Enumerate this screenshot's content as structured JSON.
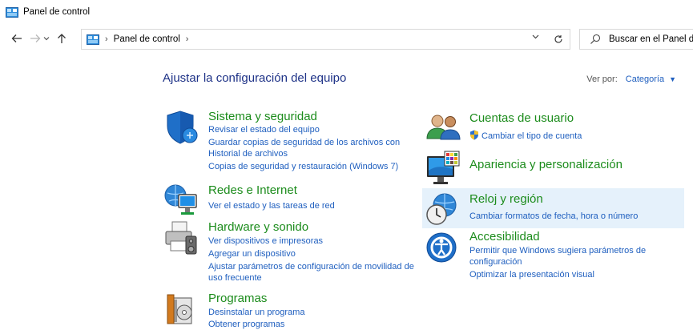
{
  "window": {
    "title": "Panel de control"
  },
  "address": {
    "crumb": "Panel de control",
    "separator": "›"
  },
  "search": {
    "placeholder": "Buscar en el Panel de"
  },
  "heading": "Ajustar la configuración del equipo",
  "view_by": {
    "label": "Ver por:",
    "value": "Categoría"
  },
  "categories": {
    "system": {
      "title": "Sistema y seguridad",
      "links": [
        "Revisar el estado del equipo",
        "Guardar copias de seguridad de los archivos con",
        "Historial de archivos",
        "Copias de seguridad y restauración (Windows 7)"
      ]
    },
    "network": {
      "title": "Redes e Internet",
      "links": [
        "Ver el estado y las tareas de red"
      ]
    },
    "hardware": {
      "title": "Hardware y sonido",
      "links": [
        "Ver dispositivos e impresoras",
        "Agregar un dispositivo",
        "Ajustar parámetros de configuración de movilidad de",
        "uso frecuente"
      ]
    },
    "programs": {
      "title": "Programas",
      "links": [
        "Desinstalar un programa",
        "Obtener programas"
      ]
    },
    "users": {
      "title": "Cuentas de usuario",
      "links": [
        "Cambiar el tipo de cuenta"
      ]
    },
    "appearance": {
      "title": "Apariencia y personalización",
      "links": []
    },
    "clock": {
      "title": "Reloj y región",
      "links": [
        "Cambiar formatos de fecha, hora o número"
      ]
    },
    "access": {
      "title": "Accesibilidad",
      "links": [
        "Permitir que Windows sugiera parámetros de",
        "configuración",
        "Optimizar la presentación visual"
      ]
    }
  },
  "colors": {
    "link": "#1f5fbf",
    "category_title": "#1c8c1c",
    "heading": "#1e3287",
    "hover": "#e5f1fb"
  }
}
